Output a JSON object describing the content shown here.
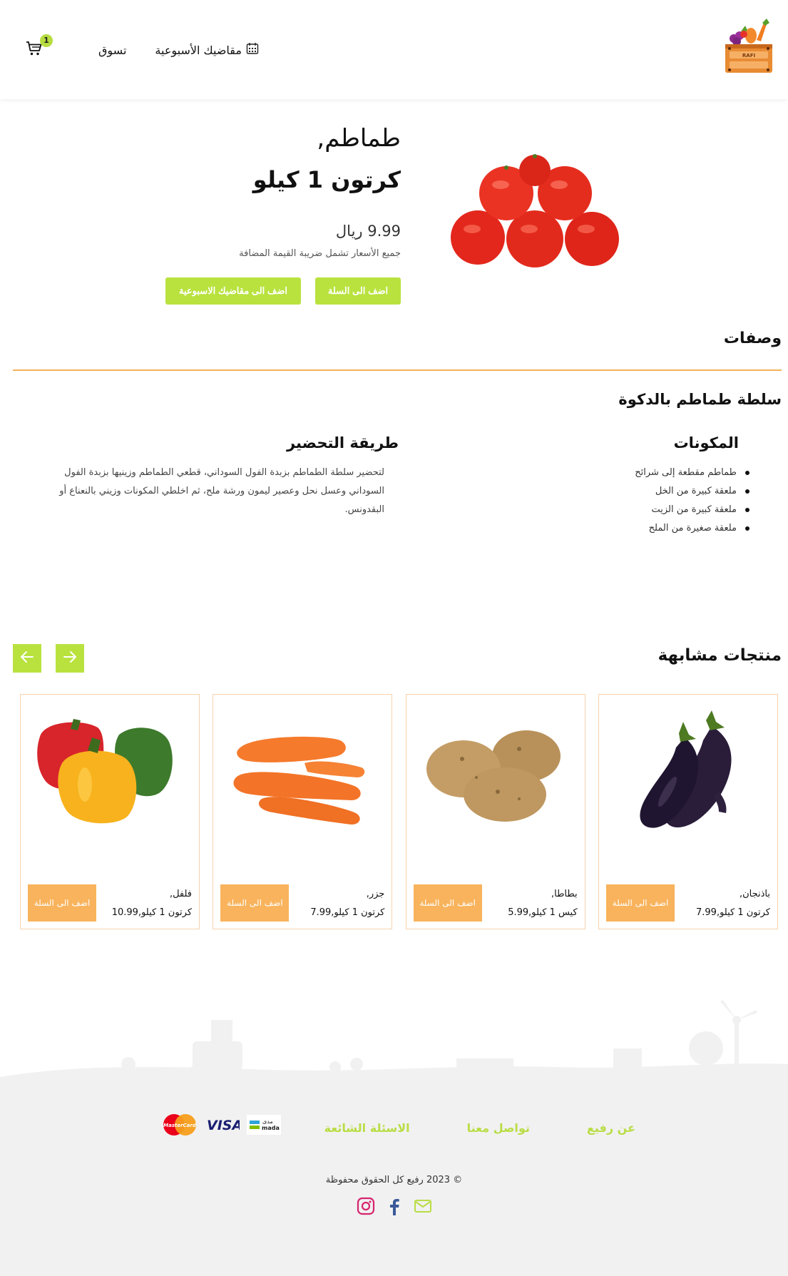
{
  "header": {
    "logo_text": "RAFI",
    "nav": {
      "weekly_label": "مقاضيك الأسبوعية",
      "shop_label": "تسوق"
    },
    "cart_count": "1"
  },
  "product": {
    "name": "طماطم,",
    "pack": "كرتون 1 كيلو",
    "price": "9.99 ريال",
    "vat_note": "جميع الأسعار تشمل ضريبة القيمة المضافة",
    "add_to_cart_label": "اضف الى السلة",
    "add_to_weekly_label": "اضف الى مقاضيك الاسبوعية"
  },
  "recipes": {
    "title": "وصفات",
    "recipe_name": "سلطة طماطم بالدكوة",
    "ingredients_title": "المكونات",
    "ingredients": [
      "طماطم مقطعة إلى شرائح",
      "ملعقة كبيرة من الخل",
      "ملعقة كبيرة من الزيت",
      "ملعقة صغيرة من الملح"
    ],
    "preparation_title": "طريقة التحضير",
    "preparation_text": "لتحضير سلطة الطماطم بزبدة الفول السوداني، قطعي الطماطم وزينيها بزبدة الفول السوداني وعسل نحل وعصير ليمون ورشة ملح، ثم اخلطي المكونات وزيني بالنعناع أو البقدونس."
  },
  "similar": {
    "title": "منتجات مشابهة",
    "items": [
      {
        "name": "باذنجان,",
        "pack": "كرتون 1 كيلو,7.99",
        "button": "اضف الى السلة",
        "image": "eggplant"
      },
      {
        "name": "بطاطا,",
        "pack": "كيس 1 كيلو,5.99",
        "button": "اضف الى السلة",
        "image": "potato"
      },
      {
        "name": "جزر,",
        "pack": "كرتون 1 كيلو,7.99",
        "button": "اضف الى السلة",
        "image": "carrot"
      },
      {
        "name": "فلفل,",
        "pack": "كرتون 1 كيلو,10.99",
        "button": "اضف الى السلة",
        "image": "pepper"
      }
    ]
  },
  "footer": {
    "links": [
      "عن رفيع",
      "تواصل معنا",
      "الاسئلة الشائعة"
    ],
    "payments": [
      "mada",
      "VISA",
      "MasterCard"
    ],
    "mada_arabic": "مدى",
    "copyright": "© 2023 رفيع كل الحقوق محفوظة",
    "socials": [
      "instagram-icon",
      "facebook-icon",
      "mail-icon"
    ]
  },
  "colors": {
    "accent_green": "#b9e23f",
    "accent_orange": "#f8b35c",
    "divider_orange": "#f5b15a",
    "footer_bg": "#f1f1f1",
    "instagram": "#d6246e",
    "facebook": "#3b5998"
  }
}
